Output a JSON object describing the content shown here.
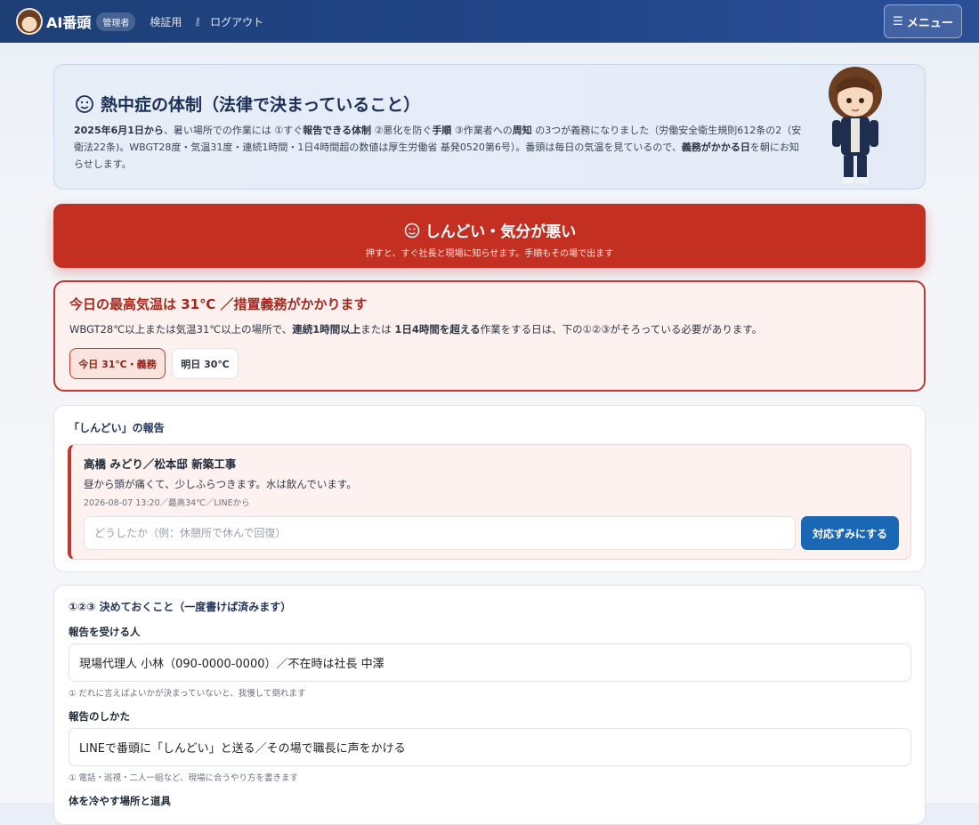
{
  "header": {
    "brand": "AI番頭",
    "role_badge": "管理者",
    "nav_verify": "検証用",
    "nav_logout": "ログアウト",
    "menu_label": "メニュー"
  },
  "intro": {
    "title": "熱中症の体制（法律で決まっていること）",
    "body_parts": {
      "p1": "2025年6月1日から",
      "p2": "、暑い場所での作業には ①すぐ",
      "p3": "報告できる体制",
      "p4": " ②悪化を防ぐ",
      "p5": "手順",
      "p6": " ③作業者への",
      "p7": "周知",
      "p8": " の3つが義務になりました（労働安全衛生規則612条の2（安衛法22条)。WBGT28度・気温31度・連続1時間・1日4時間超の数値は厚生労働省 基発0520第6号）。番頭は毎日の気温を見ているので、",
      "p9": "義務がかかる日",
      "p10": "を朝にお知らせします。"
    }
  },
  "sos": {
    "title": "しんどい・気分が悪い",
    "subtitle": "押すと、すぐ社長と現場に知らせます。手順もその場で出ます"
  },
  "warning": {
    "title": "今日の最高気温は 31℃ ／措置義務がかかります",
    "body_parts": {
      "p1": "WBGT28℃以上または気温31℃以上の場所で、",
      "p2": "連続1時間以上",
      "p3": "または ",
      "p4": "1日4時間を超える",
      "p5": "作業をする日は、下の①②③がそろっている必要があります。"
    },
    "today_pill": "今日 31℃・義務",
    "tomorrow_pill": "明日 30℃"
  },
  "report": {
    "section_title": "「しんどい」の報告",
    "reporter": "高橋 みどり／松本邸 新築工事",
    "message": "昼から頭が痛くて、少しふらつきます。水は飲んでいます。",
    "meta": "2026-08-07 13:20／最高34℃／LINEから",
    "resolve_placeholder": "どうしたか（例：休憩所で休んで回復）",
    "resolve_button": "対応ずみにする"
  },
  "settings": {
    "section_title": "①②③ 決めておくこと（一度書けば済みます）",
    "fields": [
      {
        "label": "報告を受ける人",
        "value": "現場代理人 小林（090-0000-0000）／不在時は社長 中澤",
        "hint": "① だれに言えばよいかが決まっていないと、我慢して倒れます"
      },
      {
        "label": "報告のしかた",
        "value": "LINEで番頭に「しんどい」と送る／その場で職長に声をかける",
        "hint": "① 電話・巡視・二人一組など、現場に合うやり方を書きます"
      },
      {
        "label": "体を冷やす場所と道具",
        "value": "",
        "hint": ""
      }
    ]
  },
  "colors": {
    "header_bg": "#23468a",
    "alert_red": "#c33022",
    "primary_blue": "#1a67b6"
  },
  "icons": [
    "face-hot-icon",
    "key-icon",
    "hamburger-icon"
  ]
}
